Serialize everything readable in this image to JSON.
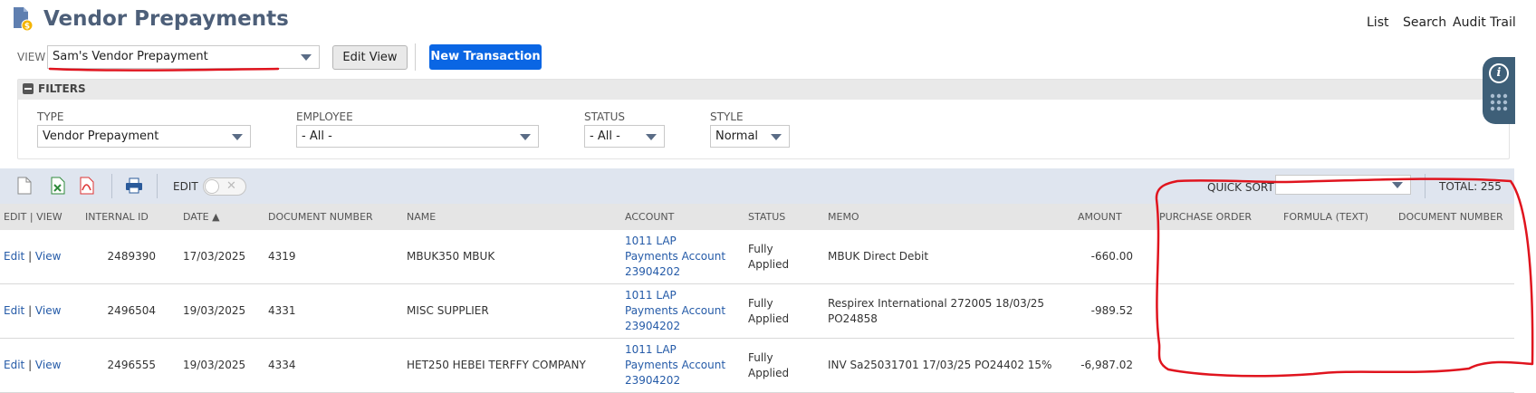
{
  "header": {
    "title": "Vendor Prepayments",
    "links": [
      "List",
      "Search",
      "Audit Trail"
    ]
  },
  "view_bar": {
    "label": "VIEW",
    "selected_view": "Sam's Vendor Prepayment",
    "edit_view_label": "Edit View",
    "new_transaction_label": "New Transaction"
  },
  "filters": {
    "title": "FILTERS",
    "fields": [
      {
        "label": "TYPE",
        "value": "Vendor Prepayment"
      },
      {
        "label": "EMPLOYEE",
        "value": "- All -"
      },
      {
        "label": "STATUS",
        "value": "- All -"
      },
      {
        "label": "STYLE",
        "value": "Normal"
      }
    ]
  },
  "toolbar": {
    "icons": [
      "export-csv-icon",
      "export-excel-icon",
      "export-pdf-icon",
      "print-icon"
    ],
    "edit_label": "EDIT",
    "edit_toggle_on": false,
    "quick_sort_label": "QUICK SORT",
    "quick_sort_value": "",
    "total_label": "TOTAL: 255"
  },
  "table": {
    "columns": [
      "EDIT | VIEW",
      "INTERNAL ID",
      "DATE ▲",
      "DOCUMENT NUMBER",
      "NAME",
      "ACCOUNT",
      "STATUS",
      "MEMO",
      "AMOUNT",
      "PURCHASE ORDER",
      "FORMULA (TEXT)",
      "DOCUMENT NUMBER"
    ],
    "rows": [
      {
        "edit": "Edit",
        "view": "View",
        "internal_id": "2489390",
        "date": "17/03/2025",
        "doc_number": "4319",
        "name": "MBUK350 MBUK",
        "account": [
          "1011 LAP",
          "Payments Account",
          "23904202"
        ],
        "status": [
          "Fully",
          "Applied"
        ],
        "memo": [
          "MBUK Direct Debit"
        ],
        "amount": "-660.00"
      },
      {
        "edit": "Edit",
        "view": "View",
        "internal_id": "2496504",
        "date": "19/03/2025",
        "doc_number": "4331",
        "name": "MISC SUPPLIER",
        "account": [
          "1011 LAP",
          "Payments Account",
          "23904202"
        ],
        "status": [
          "Fully",
          "Applied"
        ],
        "memo": [
          "Respirex International 272005 18/03/25",
          "PO24858"
        ],
        "amount": "-989.52"
      },
      {
        "edit": "Edit",
        "view": "View",
        "internal_id": "2496555",
        "date": "19/03/2025",
        "doc_number": "4334",
        "name": "HET250 HEBEI TERFFY COMPANY",
        "account": [
          "1011 LAP",
          "Payments Account",
          "23904202"
        ],
        "status": [
          "Fully",
          "Applied"
        ],
        "memo": [
          "INV Sa25031701 17/03/25 PO24402 15%"
        ],
        "amount": "-6,987.02"
      }
    ]
  },
  "side_widget": {
    "icons": [
      "info-icon",
      "keypad-icon"
    ]
  },
  "colors": {
    "title": "#4d5f79",
    "primary_button": "#0a66e4",
    "link": "#255ba8",
    "toolbar_bg": "#dfe5ef",
    "annotation_red": "#e0141e"
  }
}
